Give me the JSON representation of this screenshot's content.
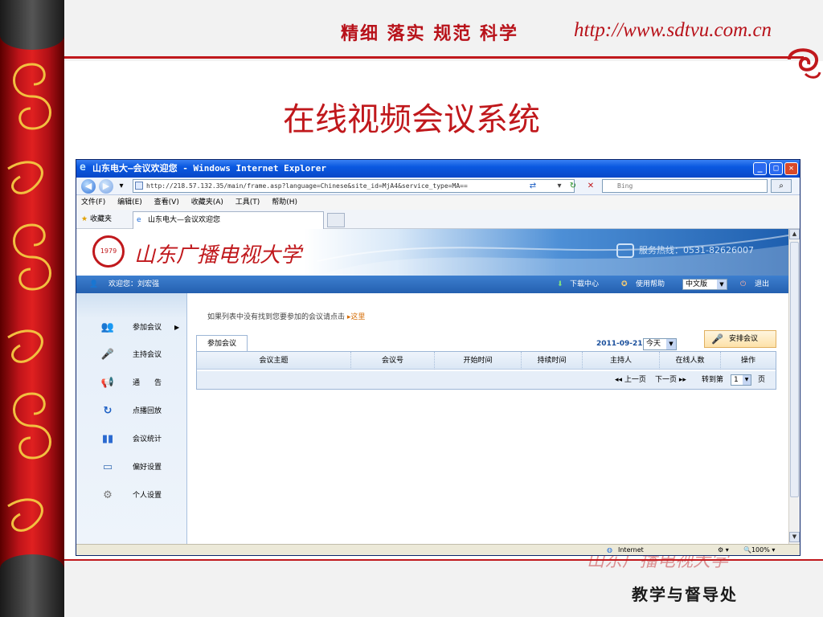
{
  "slide": {
    "motto": "精细 落实 规范 科学",
    "url": "http://www.sdtvu.com.cn",
    "title": "在线视频会议系统",
    "department": "教学与督导处",
    "bottom_logo": "山东广播电视大学",
    "colors": {
      "accent_red": "#c0181c",
      "window_blue": "#0a58e0",
      "banner_blue": "#1e5faf"
    }
  },
  "browser": {
    "title": "山东电大—会议欢迎您 - Windows Internet Explorer",
    "address": "http://218.57.132.35/main/frame.asp?language=Chinese&site_id=MjA4&service_type=MA==",
    "search_placeholder": "Bing",
    "menu": [
      "文件(F)",
      "编辑(E)",
      "查看(V)",
      "收藏夹(A)",
      "工具(T)",
      "帮助(H)"
    ],
    "favorites_label": "收藏夹",
    "tab_label": "山东电大—会议欢迎您",
    "status": {
      "zone": "Internet",
      "zoom": "100%"
    }
  },
  "page": {
    "school_name": "山东广播电视大学",
    "seal_year": "1979",
    "hotline": "服务热线：0531-82626007",
    "welcome": "欢迎您：刘宏强",
    "download": "下载中心",
    "help": "使用帮助",
    "language": "中文版",
    "logout": "退出",
    "nav": [
      {
        "label": "参加会议",
        "icon": "meeting-icon"
      },
      {
        "label": "主持会议",
        "icon": "microphone-icon"
      },
      {
        "label": "通　　告",
        "icon": "megaphone-icon"
      },
      {
        "label": "点播回放",
        "icon": "replay-icon"
      },
      {
        "label": "会议统计",
        "icon": "bar-chart-icon"
      },
      {
        "label": "偏好设置",
        "icon": "monitor-icon"
      },
      {
        "label": "个人设置",
        "icon": "gear-icon"
      }
    ],
    "hint": "如果列表中没有找到您要参加的会议请点击",
    "hint_link": "这里",
    "meeting_tab": "参加会议",
    "date": "2011-09-21",
    "day_filter": "今天",
    "arrange_button": "安排会议",
    "columns": [
      "会议主题",
      "会议号",
      "开始时间",
      "持续时间",
      "主持人",
      "在线人数",
      "操作"
    ],
    "pager": {
      "prev": "上一页",
      "next": "下一页",
      "goto": "转到第",
      "page": "1",
      "suffix": "页"
    }
  }
}
